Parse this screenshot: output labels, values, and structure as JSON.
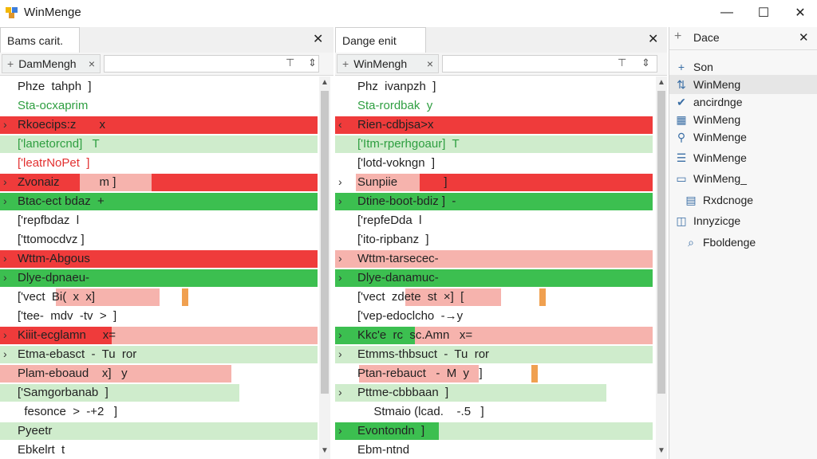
{
  "window": {
    "title": "WinMenge",
    "minimize_glyph": "—",
    "maximize_glyph": "☐",
    "close_glyph": "✕"
  },
  "left_pane": {
    "tab_title": "Bams carit.",
    "close_glyph": "✕",
    "file_tab": "DamMengh",
    "lines": [
      {
        "text": "Phze  tahph  ]"
      },
      {
        "text": "Sta-ocxaprim"
      },
      {
        "text": "Rkoecips:z       x",
        "mark": "›"
      },
      {
        "text": "['lanetorcnd]   T"
      },
      {
        "text": "['leatrNoPet  ]"
      },
      {
        "text": "Zvonaiz            m ]",
        "mark": "›"
      },
      {
        "text": "Btac-ect bdaz  +",
        "mark": "›"
      },
      {
        "text": "['repfbdaz  l"
      },
      {
        "text": "['ttomocdvz ]"
      },
      {
        "text": "Wttm-Abgous",
        "mark": "›"
      },
      {
        "text": "Dlye-dpnaeu-",
        "mark": "›"
      },
      {
        "text": "['vect  Bi(  x  x]"
      },
      {
        "text": "['tee-  mdv  -tv  >  ]"
      },
      {
        "text": "Kiiit-ecglamn     x=",
        "mark": "›"
      },
      {
        "text": "Etma-ebasct  -  Tu  ror",
        "mark": "›"
      },
      {
        "text": "Plam-eboaud    x]   y"
      },
      {
        "text": "['Samgorbanab  ]"
      },
      {
        "text": "  fesonce  >  -+2   ]"
      },
      {
        "text": "Pyeetr"
      },
      {
        "text": "Ebkelrt  t"
      }
    ]
  },
  "right_pane": {
    "tab_title": "Dange enit",
    "close_glyph": "✕",
    "file_tab": "WinMengh",
    "lines": [
      {
        "text": "Phz  ivanpzh  ]"
      },
      {
        "text": "Sta-rordbak  y"
      },
      {
        "text": "Rien-cdbjsa>x",
        "mark": "‹"
      },
      {
        "text": "['Itm-rperhgoaur]  T"
      },
      {
        "text": "['lotd-vokngn  ]"
      },
      {
        "text": "Sunpiie              ]",
        "mark": "›"
      },
      {
        "text": "Dtine-boot-bdiz ]  -",
        "mark": "›"
      },
      {
        "text": "['repfeDda  l"
      },
      {
        "text": "['ito-ripbanz  ]"
      },
      {
        "text": "Wttm-tarsecec-",
        "mark": "›"
      },
      {
        "text": "Dlye-danamuc-",
        "mark": "›"
      },
      {
        "text": "['vect  zdete  st  ×]  ["
      },
      {
        "text": "['vep-edoclcho  -→y"
      },
      {
        "text": "Kkc'e  rc  sc.Amn   x=",
        "mark": "›"
      },
      {
        "text": "Etmms-thbsuct  -  Tu  ror",
        "mark": "›"
      },
      {
        "text": "Ptan-rebauct   -  M  y   ]"
      },
      {
        "text": "Pttme-cbbbaan  ]",
        "mark": "›"
      },
      {
        "text": "  Stmaio (lcad.    -.5   ]"
      },
      {
        "text": "Evontondn  ]",
        "mark": "›"
      },
      {
        "text": "Ebm-ntnd"
      }
    ]
  },
  "side_panel": {
    "header": "Dace",
    "close_glyph": "✕",
    "items": [
      {
        "label": "Son",
        "icon": "plus-icon",
        "glyph": "+"
      },
      {
        "label": "WinMeng",
        "icon": "sort-icon",
        "glyph": "⇅"
      },
      {
        "label": "ancirdnge",
        "icon": "check-icon",
        "glyph": "✔"
      },
      {
        "label": "WinMeng",
        "icon": "table-icon",
        "glyph": "▦"
      },
      {
        "label": "WinMenge",
        "icon": "link-icon",
        "glyph": "⚲"
      },
      {
        "label": "WinMenge",
        "icon": "list-icon",
        "glyph": "☰"
      },
      {
        "label": "WinMeng_",
        "icon": "folder-icon",
        "glyph": "▭"
      },
      {
        "label": "Rxdcnoge",
        "icon": "doc-icon",
        "glyph": "▤"
      },
      {
        "label": "Innyzicge",
        "icon": "compare-icon",
        "glyph": "◫"
      },
      {
        "label": "Fboldenge",
        "icon": "search-icon",
        "glyph": "⌕"
      }
    ]
  },
  "colors": {
    "red": "#ef3b3b",
    "red_light": "#f6b3ad",
    "green": "#3cbf50",
    "green_light": "#cfeccc",
    "orange": "#f0a050"
  }
}
